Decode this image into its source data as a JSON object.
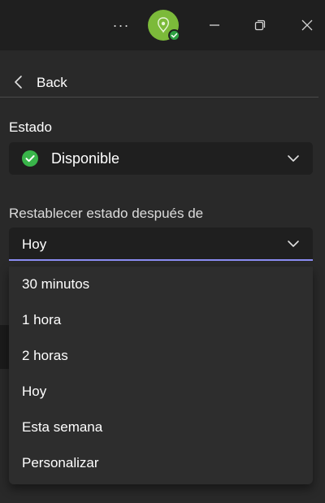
{
  "titlebar": {
    "more_label": "···"
  },
  "nav": {
    "back_label": "Back"
  },
  "status": {
    "label": "Estado",
    "value": "Disponible",
    "color": "#39b54a"
  },
  "reset": {
    "label": "Restablecer estado después de",
    "value": "Hoy",
    "options": [
      "30 minutos",
      "1 hora",
      "2 horas",
      "Hoy",
      "Esta semana",
      "Personalizar"
    ]
  },
  "colors": {
    "accent": "#8b8cf2",
    "avatar": "#7cba3a",
    "panel": "#292929",
    "titlebar": "#1f1f1f"
  }
}
